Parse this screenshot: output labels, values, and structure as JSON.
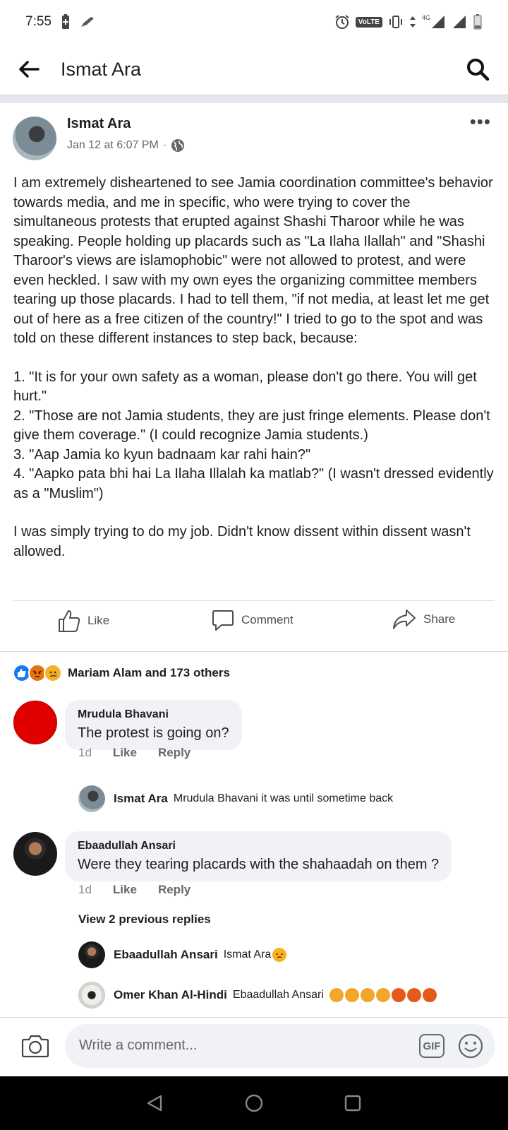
{
  "status_bar": {
    "time": "7:55",
    "volte_label": "VoLTE",
    "network": "4G"
  },
  "header": {
    "title": "Ismat Ara"
  },
  "post": {
    "author": "Ismat Ara",
    "date": "Jan 12 at 6:07 PM",
    "separator": "·",
    "paragraphs": [
      "I am extremely disheartened to see Jamia coordination committee's behavior towards media, and me in specific, who were trying to cover the simultaneous protests that erupted against Shashi Tharoor while he was speaking. People holding up placards such as \"La Ilaha Ilallah\" and \"Shashi Tharoor's views are islamophobic\" were not allowed to protest, and were even heckled. I saw with my own eyes the organizing committee members tearing up those placards. I had to tell them, \"if not media, at least let me get out of here as a free citizen of the country!\"  I tried to go to the spot and was told on these different instances to step back, because:",
      "1. \"It is for your own safety as a woman, please don't go there. You will get hurt.\"",
      "2. \"Those are not Jamia students, they are just fringe elements. Please don't give them coverage.\" (I could recognize Jamia students.)",
      "3. \"Aap Jamia ko kyun badnaam kar rahi hain?\"",
      "4. \"Aapko pata bhi hai La Ilaha Illalah ka matlab?\" (I wasn't dressed evidently as a \"Muslim\")",
      "I was simply trying to do my job. Didn't know dissent within dissent wasn't allowed."
    ]
  },
  "actions": {
    "like": "Like",
    "comment": "Comment",
    "share": "Share"
  },
  "reactions": {
    "summary": "Mariam Alam and 173 others"
  },
  "comments": [
    {
      "name": "Mrudula Bhavani",
      "text": "The protest is going on?",
      "time": "1d",
      "like": "Like",
      "reply": "Reply",
      "avatar_color": "#e00000"
    },
    {
      "name": "Ebaadullah Ansari",
      "text": "Were they tearing placards with the shahaadah on them ?",
      "time": "1d",
      "like": "Like",
      "reply": "Reply"
    }
  ],
  "replies": [
    {
      "name": "Ismat Ara",
      "text": "Mrudula Bhavani it was until sometime back"
    },
    {
      "name": "Ebaadullah Ansari",
      "text": "Ismat Ara"
    },
    {
      "name": "Omer Khan Al-Hindi",
      "text": "Ebaadullah Ansari"
    }
  ],
  "view_previous": "View 2 previous replies",
  "composer": {
    "placeholder": "Write a comment...",
    "gif_label": "GIF"
  },
  "colors": {
    "accent": "#1877f2",
    "bubble": "#f0f2f5",
    "secondary_text": "#65676b"
  }
}
